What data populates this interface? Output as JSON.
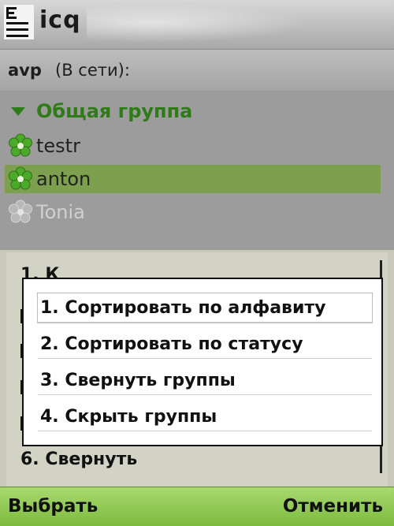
{
  "title_bar": {
    "app_name": "icq",
    "app_icon": "menu-list-icon"
  },
  "status": {
    "username": "avp",
    "state": "(В сети):"
  },
  "contact_list": {
    "group": {
      "name": "Общая группа",
      "expanded": true
    },
    "contacts": [
      {
        "name": "testr",
        "status": "online",
        "icon": "icq-flower-online-icon"
      },
      {
        "name": "anton",
        "status": "online",
        "selected": true,
        "icon": "icq-flower-online-icon"
      },
      {
        "name": "Tonia",
        "status": "offline",
        "icon": "icq-flower-offline-icon"
      }
    ]
  },
  "background_menu": {
    "top_item": "1. К",
    "bottom_item": "6. Свернуть"
  },
  "popup_menu": {
    "items": [
      {
        "label": "1. Сортировать по алфавиту",
        "selected": true
      },
      {
        "label": "2. Сортировать по статусу"
      },
      {
        "label": "3. Свернуть группы"
      },
      {
        "label": "4. Скрыть группы"
      }
    ]
  },
  "softkeys": {
    "left": "Выбрать",
    "right": "Отменить"
  },
  "colors": {
    "accent_green": "#2e7b17",
    "selection_green": "#7da04e",
    "softkey_green": "#8fca52"
  }
}
